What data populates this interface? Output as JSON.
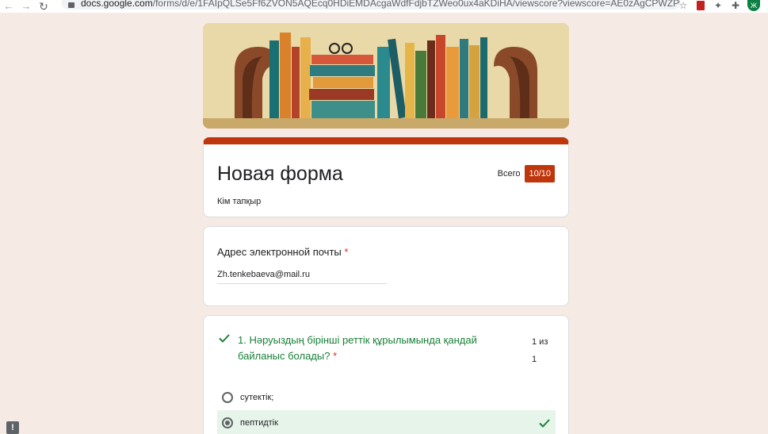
{
  "browser": {
    "url_domain": "docs.google.com",
    "url_path": "/forms/d/e/1FAIpQLSe5Ff6ZVON5AQEcq0HDiEMDAcgaWdfFdjbTZWeo0ux4aKDiHA/viewscore?viewscore=AE0zAgCPWZPyAMY0AJC8CrYaTkeNB...",
    "avatar_letter": "Ж"
  },
  "form": {
    "title": "Новая форма",
    "description": "Кім тапқыр",
    "score_label": "Всего",
    "score_value": "10/10"
  },
  "email_question": {
    "label": "Адрес электронной почты",
    "required_mark": "*",
    "value": "Zh.tenkebaeva@mail.ru"
  },
  "question_1": {
    "text": "1. Нәруыздың бірінші реттік құрылымында қандай байланыс болады?",
    "required_mark": "*",
    "points_line1": "1 из",
    "points_line2": "1",
    "options": [
      {
        "label": "сутектік;",
        "selected": false,
        "correct": false
      },
      {
        "label": "пептидтік",
        "selected": true,
        "correct": true
      }
    ]
  },
  "colors": {
    "theme": "#bf360c",
    "background": "#f6ebe4",
    "correct_text": "#188038",
    "correct_bg": "#e6f4ea"
  }
}
